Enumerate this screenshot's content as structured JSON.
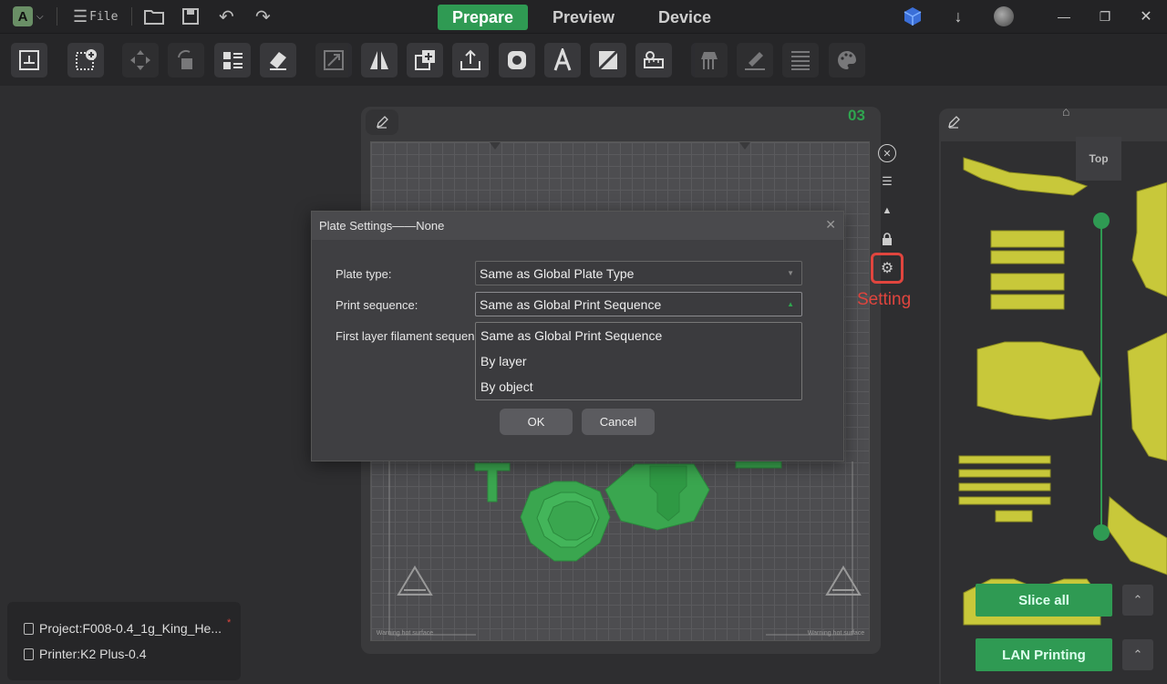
{
  "titlebar": {
    "file_label": "File",
    "tabs": [
      {
        "label": "Prepare",
        "active": true
      },
      {
        "label": "Preview",
        "active": false
      },
      {
        "label": "Device",
        "active": false
      }
    ]
  },
  "plate": {
    "number": "03",
    "warning_text": "Warning hot surface",
    "setting_label": "Setting"
  },
  "right_panel": {
    "view_label": "Top",
    "slice_all": "Slice all",
    "lan_printing": "LAN Printing"
  },
  "project": {
    "project_label": "Project:F008-0.4_1g_King_He...",
    "modified_marker": "*",
    "printer_label": "Printer:K2 Plus-0.4"
  },
  "dialog": {
    "title": "Plate Settings——None",
    "plate_type_label": "Plate type:",
    "plate_type_value": "Same as Global Plate Type",
    "print_sequence_label": "Print sequence:",
    "print_sequence_value": "Same as Global Print Sequence",
    "first_layer_label": "First layer filament sequenc",
    "options": [
      "Same as Global Print Sequence",
      "By layer",
      "By object"
    ],
    "ok": "OK",
    "cancel": "Cancel"
  },
  "colors": {
    "accent_green": "#2f9a53",
    "highlight_red": "#e0453e",
    "model_yellow": "#c8c83a",
    "model_green": "#3aa64f"
  }
}
